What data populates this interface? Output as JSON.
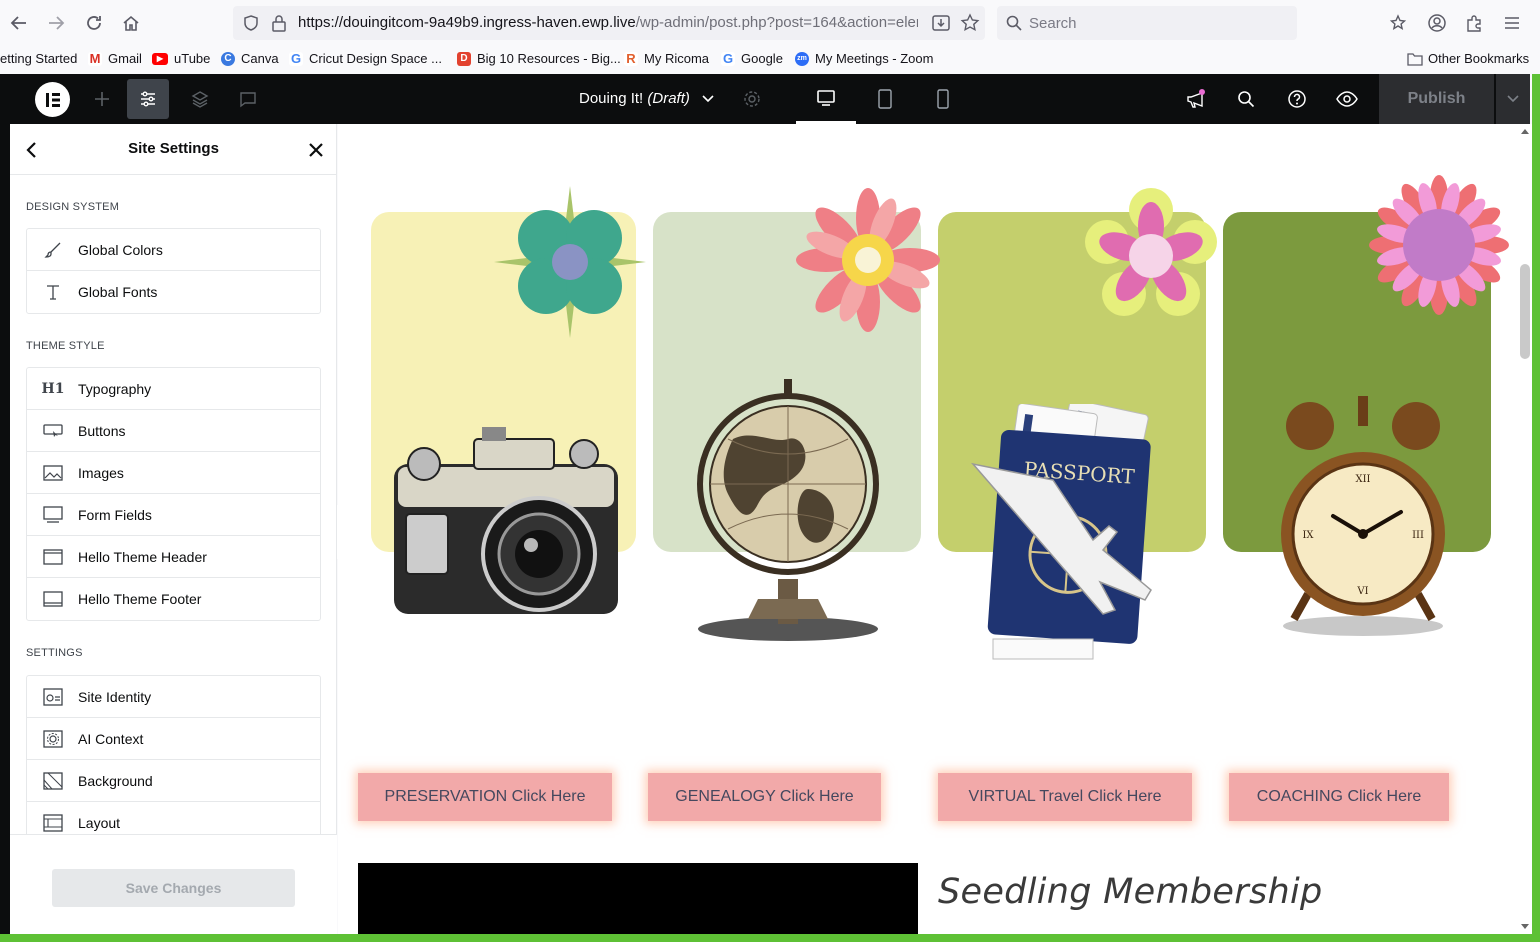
{
  "browser": {
    "url_main": "https://douingitcom-9a49b9.ingress-haven.ewp.live",
    "url_path": "/wp-admin/post.php?post=164&action=elem",
    "search_placeholder": "Search"
  },
  "bookmarks": [
    {
      "label": "etting Started",
      "icon": "firefox-icon"
    },
    {
      "label": "Gmail",
      "icon": "gmail-icon"
    },
    {
      "label": "uTube",
      "icon": "youtube-icon"
    },
    {
      "label": "Canva",
      "icon": "canva-icon"
    },
    {
      "label": "Cricut Design Space ...",
      "icon": "google-icon"
    },
    {
      "label": "Big 10 Resources - Big...",
      "icon": "d-icon"
    },
    {
      "label": "My Ricoma",
      "icon": "ricoma-icon"
    },
    {
      "label": "Google",
      "icon": "google-icon"
    },
    {
      "label": "My Meetings - Zoom",
      "icon": "zoom-icon"
    }
  ],
  "other_bookmarks": "Other Bookmarks",
  "editor": {
    "doc_title": "Douing It!",
    "doc_status": "(Draft)",
    "publish_label": "Publish"
  },
  "panel": {
    "title": "Site Settings",
    "sections": [
      {
        "heading": "DESIGN SYSTEM",
        "items": [
          {
            "label": "Global Colors",
            "icon": "brush-icon"
          },
          {
            "label": "Global Fonts",
            "icon": "font-icon"
          }
        ]
      },
      {
        "heading": "THEME STYLE",
        "items": [
          {
            "label": "Typography",
            "icon": "h1-icon"
          },
          {
            "label": "Buttons",
            "icon": "button-icon"
          },
          {
            "label": "Images",
            "icon": "image-icon"
          },
          {
            "label": "Form Fields",
            "icon": "form-icon"
          },
          {
            "label": "Hello Theme Header",
            "icon": "header-icon"
          },
          {
            "label": "Hello Theme Footer",
            "icon": "footer-icon"
          }
        ]
      },
      {
        "heading": "SETTINGS",
        "items": [
          {
            "label": "Site Identity",
            "icon": "identity-icon"
          },
          {
            "label": "AI Context",
            "icon": "ai-icon"
          },
          {
            "label": "Background",
            "icon": "background-icon"
          },
          {
            "label": "Layout",
            "icon": "layout-icon"
          }
        ]
      }
    ],
    "save_label": "Save Changes"
  },
  "page": {
    "cards": [
      {
        "name": "camera",
        "color": "#f7f1b6",
        "illustration": "camera-illustration"
      },
      {
        "name": "globe",
        "color": "#d7e2c8",
        "illustration": "globe-illustration"
      },
      {
        "name": "passport",
        "color": "#c4cf6c",
        "illustration": "passport-illustration"
      },
      {
        "name": "clock",
        "color": "#7c9a3e",
        "illustration": "clock-illustration"
      }
    ],
    "buttons": [
      {
        "label": "PRESERVATION Click Here"
      },
      {
        "label": "GENEALOGY Click Here"
      },
      {
        "label": "VIRTUAL Travel Click Here"
      },
      {
        "label": "COACHING Click Here"
      }
    ],
    "heading": "Seedling Membership"
  }
}
